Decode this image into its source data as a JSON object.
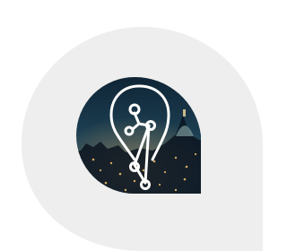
{
  "colors": {
    "background": "#ffffff",
    "backdrop_shape": "#eeeeee",
    "sky_top": "#0e2233",
    "sky_mid": "#1c3f52",
    "sky_bottom": "#27526a",
    "city_dark": "#0b1420",
    "city_light": "#d9a65c",
    "icon_stroke": "#ffffff"
  },
  "icons": {
    "backdrop": "teardrop-map-pin-shape",
    "photo": "night-city-skyline-photo",
    "logo": "map-pin-network-nodes-icon"
  }
}
